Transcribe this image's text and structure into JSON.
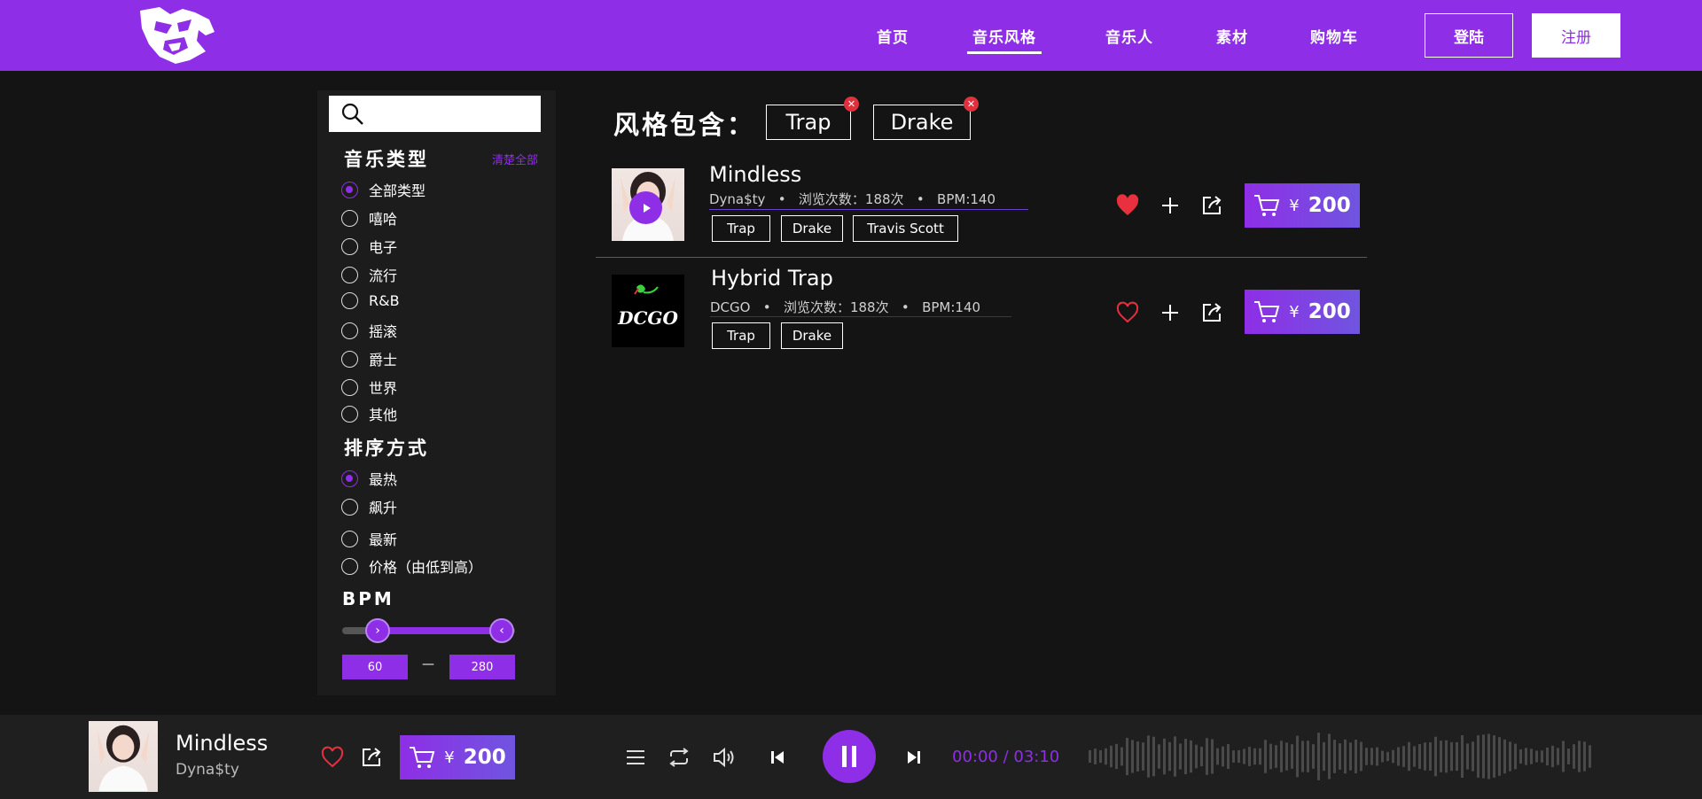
{
  "header": {
    "logo_icon": "tiger-head-logo-icon",
    "nav": [
      "首页",
      "音乐风格",
      "音乐人",
      "素材",
      "购物车"
    ],
    "active_nav": "音乐风格",
    "login": "登陆",
    "register": "注册",
    "brand_color": "#8e2ee6"
  },
  "sidebar": {
    "search_placeholder": "",
    "music_type_title": "音乐类型",
    "clear_all": "清楚全部",
    "music_types": [
      "全部类型",
      "嘻哈",
      "电子",
      "流行",
      "R&B",
      "摇滚",
      "爵士",
      "世界",
      "其他"
    ],
    "music_type_selected": "全部类型",
    "sort_title": "排序方式",
    "sort_options": [
      "最热",
      "飙升",
      "最新",
      "价格（由低到高）"
    ],
    "sort_selected": "最热",
    "bpm_title": "BPM",
    "bpm_min": "60",
    "bpm_max": "280",
    "bpm_dash": "—"
  },
  "filter": {
    "label": "风格包含：",
    "chips": [
      "Trap",
      "Drake"
    ],
    "remove_icon": "close-icon"
  },
  "tracks": [
    {
      "title": "Mindless",
      "artist": "Dyna$ty",
      "views": "浏览次数：188次",
      "bpm": "BPM:140",
      "tags": [
        "Trap",
        "Drake",
        "Travis Scott"
      ],
      "liked": true,
      "price_currency": "¥",
      "price": "200"
    },
    {
      "title": "Hybrid Trap",
      "artist": "DCGO",
      "views": "浏览次数：188次",
      "bpm": "BPM:140",
      "tags": [
        "Trap",
        "Drake"
      ],
      "liked": false,
      "price_currency": "¥",
      "price": "200",
      "cover_text": "DCGO"
    }
  ],
  "meta_separator": "•",
  "player": {
    "title": "Mindless",
    "artist": "Dyna$ty",
    "price_currency": "¥",
    "price": "200",
    "time": "00:00 / 03:10",
    "state": "playing"
  }
}
